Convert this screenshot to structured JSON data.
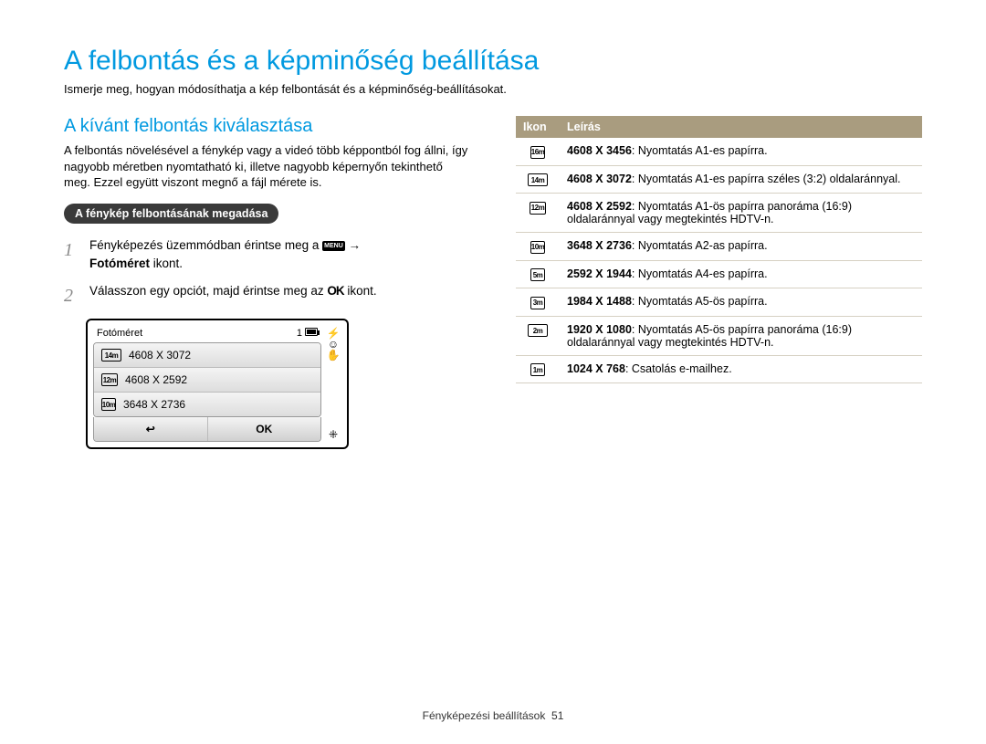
{
  "title": "A felbontás és a képminőség beállítása",
  "intro": "Ismerje meg, hogyan módosíthatja a kép felbontását és a képminőség-beállításokat.",
  "subtitle": "A kívánt felbontás kiválasztása",
  "paragraph": "A felbontás növelésével a fénykép vagy a videó több képpontból fog állni, így nagyobb méretben nyomtatható ki, illetve nagyobb képernyőn tekinthető meg. Ezzel együtt viszont megnő a fájl mérete is.",
  "pill": "A fénykép felbontásának megadása",
  "steps": {
    "1": {
      "pre": "Fényképezés üzemmódban érintse meg a ",
      "menu": "MENU",
      "arrow": "→",
      "post": "Fotóméret",
      "tail": " ikont."
    },
    "2": {
      "pre": "Válasszon egy opciót, majd érintse meg az ",
      "ok": "OK",
      "tail": " ikont."
    }
  },
  "camera": {
    "title": "Fotóméret",
    "page": "1",
    "rows": [
      {
        "iconText": "14m",
        "iconClass": "",
        "label": "4608 X 3072"
      },
      {
        "iconText": "12m",
        "iconClass": "square",
        "label": "4608 X 2592"
      },
      {
        "iconText": "10m",
        "iconClass": "tall",
        "label": "3648 X 2736"
      }
    ],
    "back": "↩",
    "ok": "OK"
  },
  "table": {
    "headerIcon": "Ikon",
    "headerDesc": "Leírás",
    "rows": [
      {
        "icon": "16m",
        "iconClass": "tall",
        "reso": "4608 X 3456",
        "desc": ": Nyomtatás A1-es papírra."
      },
      {
        "icon": "14m",
        "iconClass": "",
        "reso": "4608 X 3072",
        "desc": ": Nyomtatás A1-es papírra széles (3:2) oldalaránnyal."
      },
      {
        "icon": "12m",
        "iconClass": "square",
        "reso": "4608 X 2592",
        "desc": ": Nyomtatás A1-ös papírra panoráma (16:9) oldalaránnyal vagy megtekintés HDTV-n."
      },
      {
        "icon": "10m",
        "iconClass": "tall",
        "reso": "3648 X 2736",
        "desc": ": Nyomtatás A2-as papírra."
      },
      {
        "icon": "5m",
        "iconClass": "tall",
        "reso": "2592 X 1944",
        "desc": ": Nyomtatás A4-es papírra."
      },
      {
        "icon": "3m",
        "iconClass": "tall",
        "reso": "1984 X 1488",
        "desc": ": Nyomtatás A5-ös papírra."
      },
      {
        "icon": "2m",
        "iconClass": "",
        "reso": "1920 X 1080",
        "desc": ": Nyomtatás A5-ös papírra panoráma (16:9) oldalaránnyal vagy megtekintés HDTV-n."
      },
      {
        "icon": "1m",
        "iconClass": "tall",
        "reso": "1024 X 768",
        "desc": ": Csatolás e-mailhez."
      }
    ]
  },
  "footer": {
    "section": "Fényképezési beállítások",
    "pagenum": "51"
  }
}
